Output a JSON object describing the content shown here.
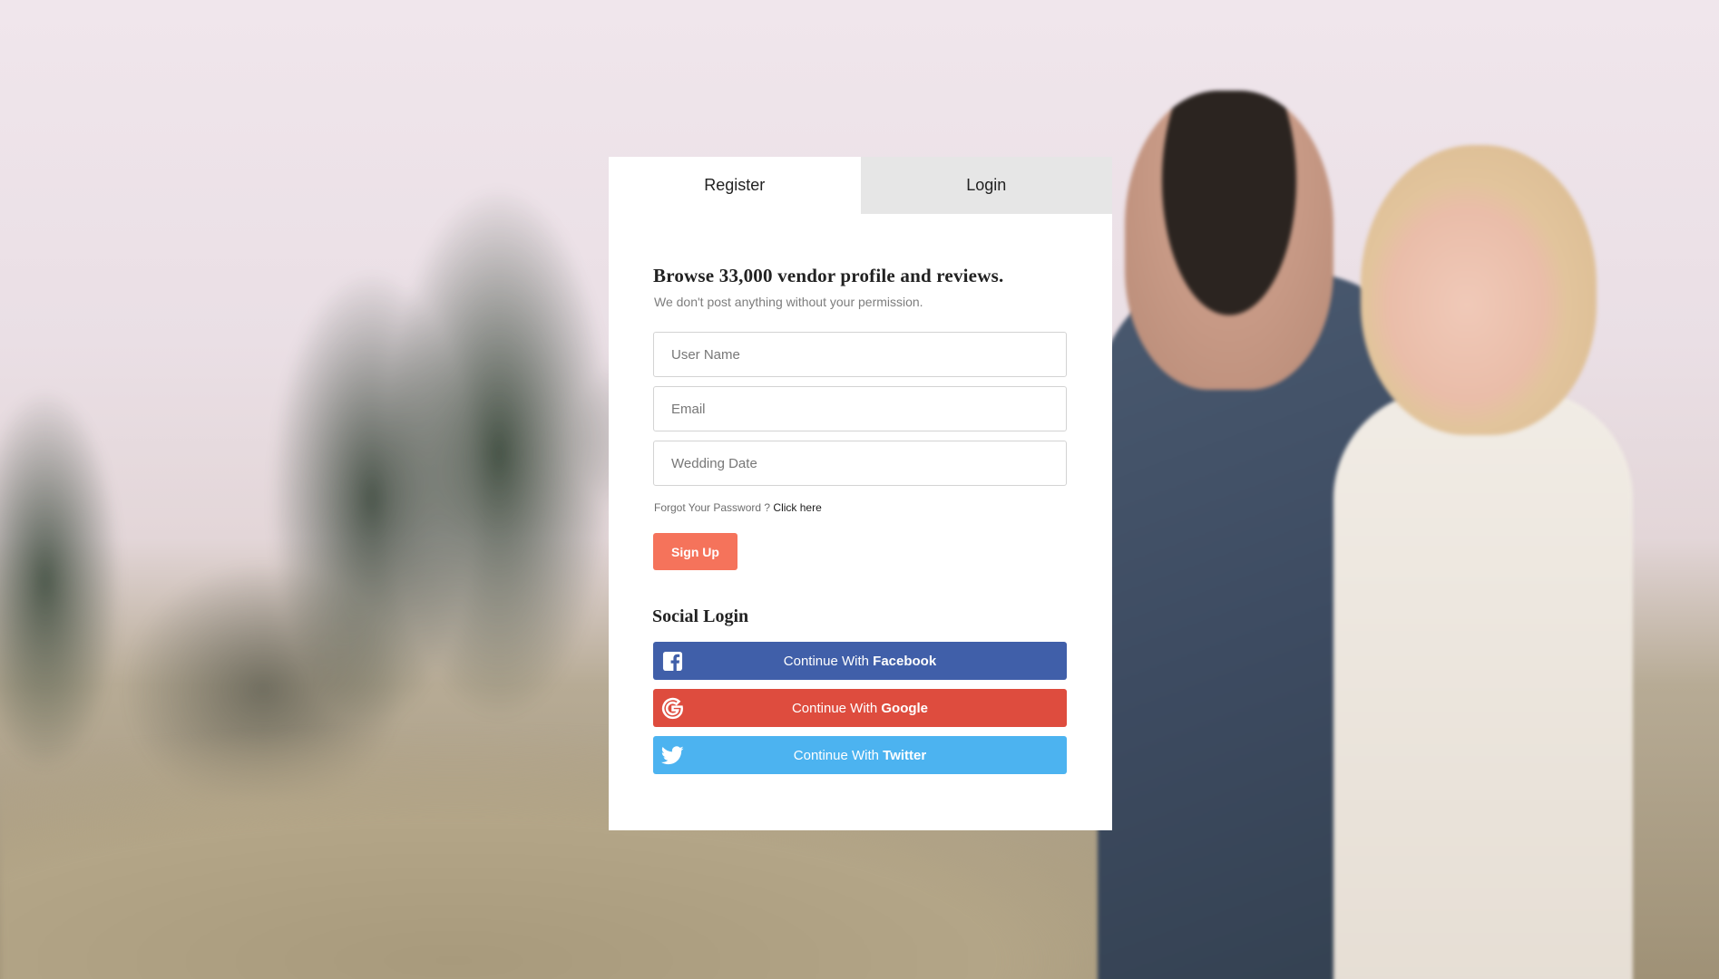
{
  "tabs": {
    "register": "Register",
    "login": "Login"
  },
  "form": {
    "headline": "Browse 33,000 vendor profile and reviews.",
    "subline": "We don't post anything without your permission.",
    "username_placeholder": "User Name",
    "email_placeholder": "Email",
    "wedding_date_placeholder": "Wedding Date",
    "forgot_text": "Forgot Your Password ?",
    "forgot_link": "Click here",
    "signup_label": "Sign Up"
  },
  "social": {
    "title": "Social Login",
    "facebook": {
      "prefix": "Continue With",
      "brand": "Facebook",
      "icon": "facebook-icon",
      "color": "#405fa9"
    },
    "google": {
      "prefix": "Continue With",
      "brand": "Google",
      "icon": "google-icon",
      "color": "#de4c3e"
    },
    "twitter": {
      "prefix": "Continue With",
      "brand": "Twitter",
      "icon": "twitter-icon",
      "color": "#4cb3f0"
    }
  },
  "colors": {
    "accent": "#f5735b",
    "inactive_tab": "#e6e6e6"
  }
}
